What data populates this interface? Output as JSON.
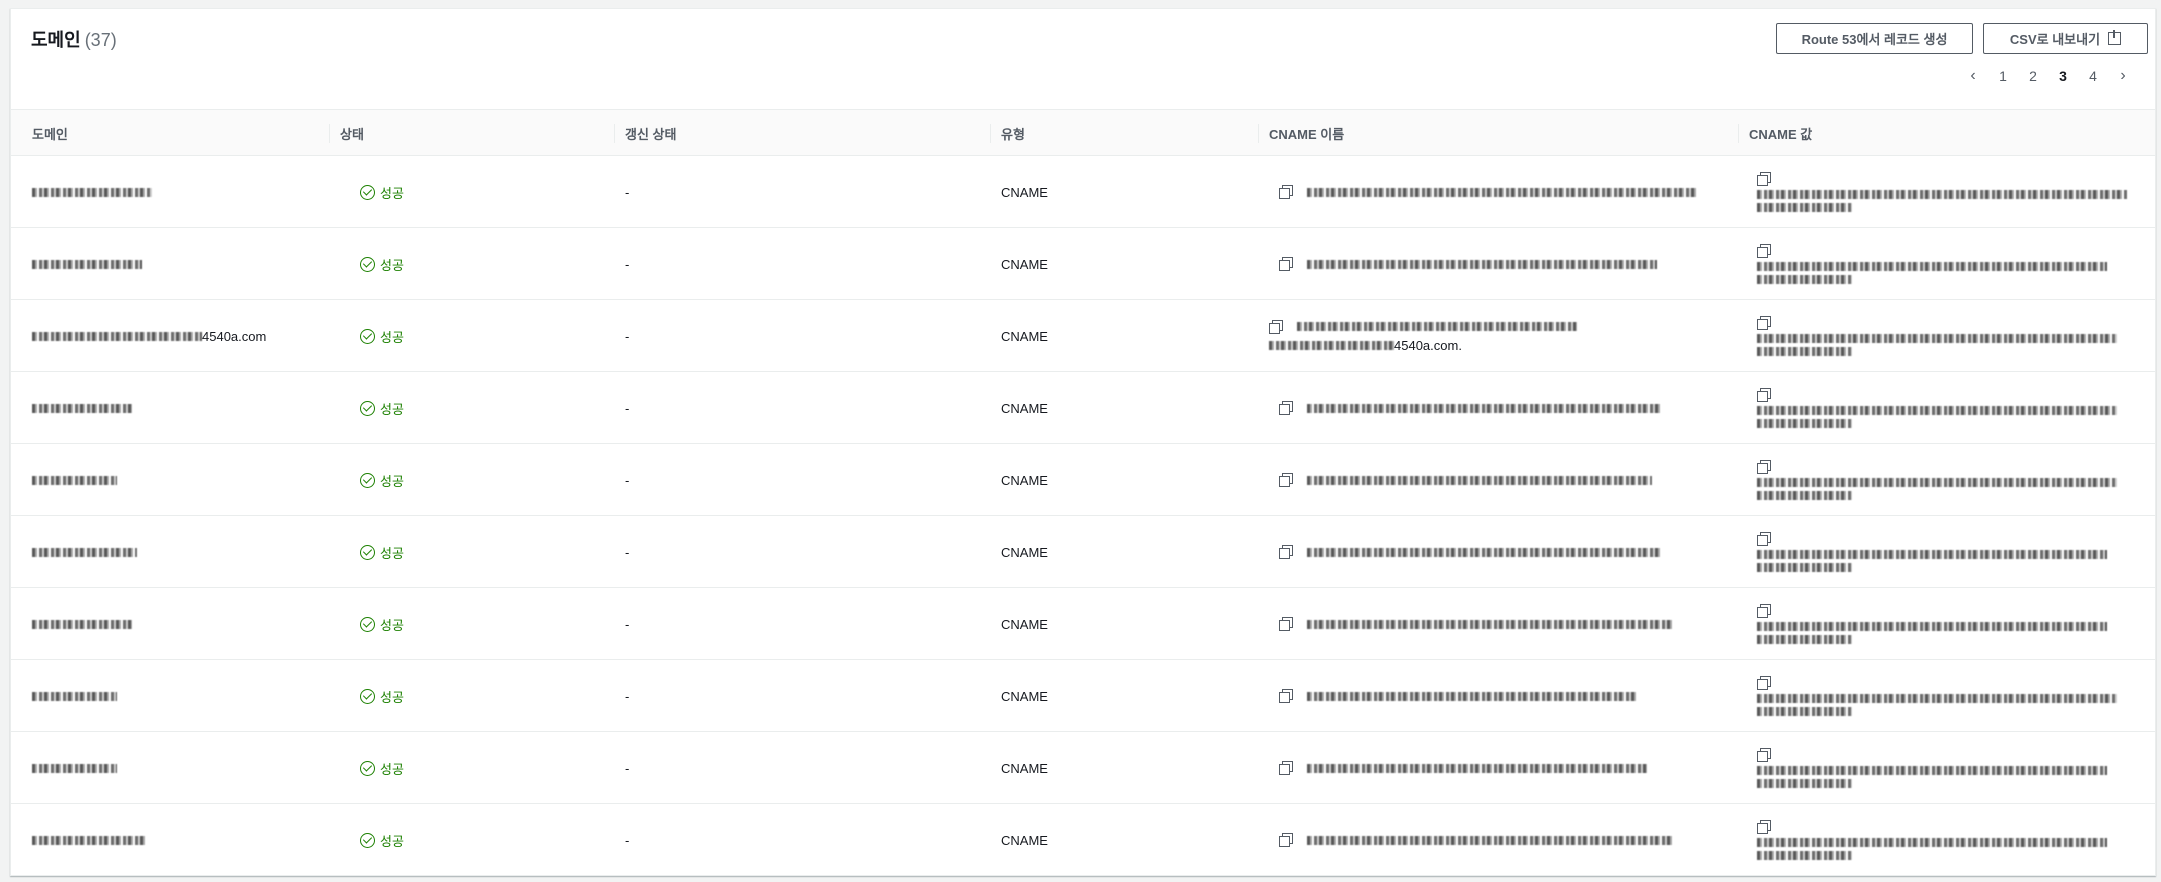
{
  "header": {
    "title": "도메인",
    "count": "(37)",
    "route53_button": "Route 53에서 레코드 생성",
    "csv_button": "CSV로 내보내기"
  },
  "pagination": {
    "prev_icon": "chevron-left-icon",
    "next_icon": "chevron-right-icon",
    "pages": [
      "1",
      "2",
      "3",
      "4"
    ],
    "current": "3"
  },
  "columns": [
    "도메인",
    "상태",
    "갱신 상태",
    "유형",
    "CNAME 이름",
    "CNAME 값"
  ],
  "status_color": "#1d8102",
  "rows": [
    {
      "domain_suffix": "",
      "status": "성공",
      "renewal": "-",
      "type": "CNAME",
      "name_suffix": ""
    },
    {
      "domain_suffix": "",
      "status": "성공",
      "renewal": "-",
      "type": "CNAME",
      "name_suffix": ""
    },
    {
      "domain_suffix": "4540a.com",
      "status": "성공",
      "renewal": "-",
      "type": "CNAME",
      "name_suffix": "4540a.com."
    },
    {
      "domain_suffix": "",
      "status": "성공",
      "renewal": "-",
      "type": "CNAME",
      "name_suffix": ""
    },
    {
      "domain_suffix": "",
      "status": "성공",
      "renewal": "-",
      "type": "CNAME",
      "name_suffix": ""
    },
    {
      "domain_suffix": "",
      "status": "성공",
      "renewal": "-",
      "type": "CNAME",
      "name_suffix": ""
    },
    {
      "domain_suffix": "",
      "status": "성공",
      "renewal": "-",
      "type": "CNAME",
      "name_suffix": ""
    },
    {
      "domain_suffix": "",
      "status": "성공",
      "renewal": "-",
      "type": "CNAME",
      "name_suffix": ""
    },
    {
      "domain_suffix": "",
      "status": "성공",
      "renewal": "-",
      "type": "CNAME",
      "name_suffix": ""
    },
    {
      "domain_suffix": "",
      "status": "성공",
      "renewal": "-",
      "type": "CNAME",
      "name_suffix": ""
    }
  ]
}
